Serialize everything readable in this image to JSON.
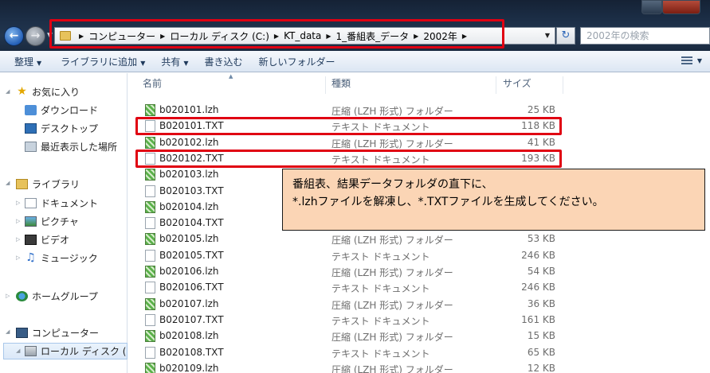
{
  "address_bar": {
    "breadcrumbs": [
      "コンピューター",
      "ローカル ディスク (C:)",
      "KT_data",
      "1_番組表_データ",
      "2002年"
    ],
    "search_placeholder": "2002年の検索"
  },
  "toolbar": {
    "items": [
      {
        "label": "整理",
        "has_dropdown": true
      },
      {
        "label": "ライブラリに追加",
        "has_dropdown": true
      },
      {
        "label": "共有",
        "has_dropdown": true
      },
      {
        "label": "書き込む",
        "has_dropdown": false
      },
      {
        "label": "新しいフォルダー",
        "has_dropdown": false
      }
    ]
  },
  "nav": {
    "favorites": "お気に入り",
    "downloads": "ダウンロード",
    "desktop": "デスクトップ",
    "recent": "最近表示した場所",
    "libraries": "ライブラリ",
    "documents": "ドキュメント",
    "pictures": "ピクチャ",
    "videos": "ビデオ",
    "music": "ミュージック",
    "homegroup": "ホームグループ",
    "computer": "コンピューター",
    "local_disk": "ローカル ディスク ("
  },
  "columns": {
    "name": "名前",
    "type": "種類",
    "size": "サイズ"
  },
  "files": [
    {
      "name": "b020101.lzh",
      "type": "圧縮 (LZH 形式) フォルダー",
      "size": "25 KB",
      "icon": "zip"
    },
    {
      "name": "B020101.TXT",
      "type": "テキスト ドキュメント",
      "size": "118 KB",
      "icon": "txt"
    },
    {
      "name": "b020102.lzh",
      "type": "圧縮 (LZH 形式) フォルダー",
      "size": "41 KB",
      "icon": "zip"
    },
    {
      "name": "B020102.TXT",
      "type": "テキスト ドキュメント",
      "size": "193 KB",
      "icon": "txt"
    },
    {
      "name": "b020103.lzh",
      "type": "",
      "size": "",
      "icon": "zip"
    },
    {
      "name": "B020103.TXT",
      "type": "",
      "size": "",
      "icon": "txt"
    },
    {
      "name": "b020104.lzh",
      "type": "",
      "size": "",
      "icon": "zip"
    },
    {
      "name": "B020104.TXT",
      "type": "",
      "size": "",
      "icon": "txt"
    },
    {
      "name": "b020105.lzh",
      "type": "圧縮 (LZH 形式) フォルダー",
      "size": "53 KB",
      "icon": "zip"
    },
    {
      "name": "B020105.TXT",
      "type": "テキスト ドキュメント",
      "size": "246 KB",
      "icon": "txt"
    },
    {
      "name": "b020106.lzh",
      "type": "圧縮 (LZH 形式) フォルダー",
      "size": "54 KB",
      "icon": "zip"
    },
    {
      "name": "B020106.TXT",
      "type": "テキスト ドキュメント",
      "size": "246 KB",
      "icon": "txt"
    },
    {
      "name": "b020107.lzh",
      "type": "圧縮 (LZH 形式) フォルダー",
      "size": "36 KB",
      "icon": "zip"
    },
    {
      "name": "B020107.TXT",
      "type": "テキスト ドキュメント",
      "size": "161 KB",
      "icon": "txt"
    },
    {
      "name": "b020108.lzh",
      "type": "圧縮 (LZH 形式) フォルダー",
      "size": "15 KB",
      "icon": "zip"
    },
    {
      "name": "B020108.TXT",
      "type": "テキスト ドキュメント",
      "size": "65 KB",
      "icon": "txt"
    },
    {
      "name": "b020109.lzh",
      "type": "圧縮 (LZH 形式) フォルダー",
      "size": "12 KB",
      "icon": "zip"
    }
  ],
  "callout": {
    "line1": "番組表、結果データフォルダの直下に、",
    "line2": "*.lzhファイルを解凍し、*.TXTファイルを生成してください。"
  },
  "colors": {
    "highlight_border": "#e00012",
    "callout_background": "#fbd5b5"
  }
}
